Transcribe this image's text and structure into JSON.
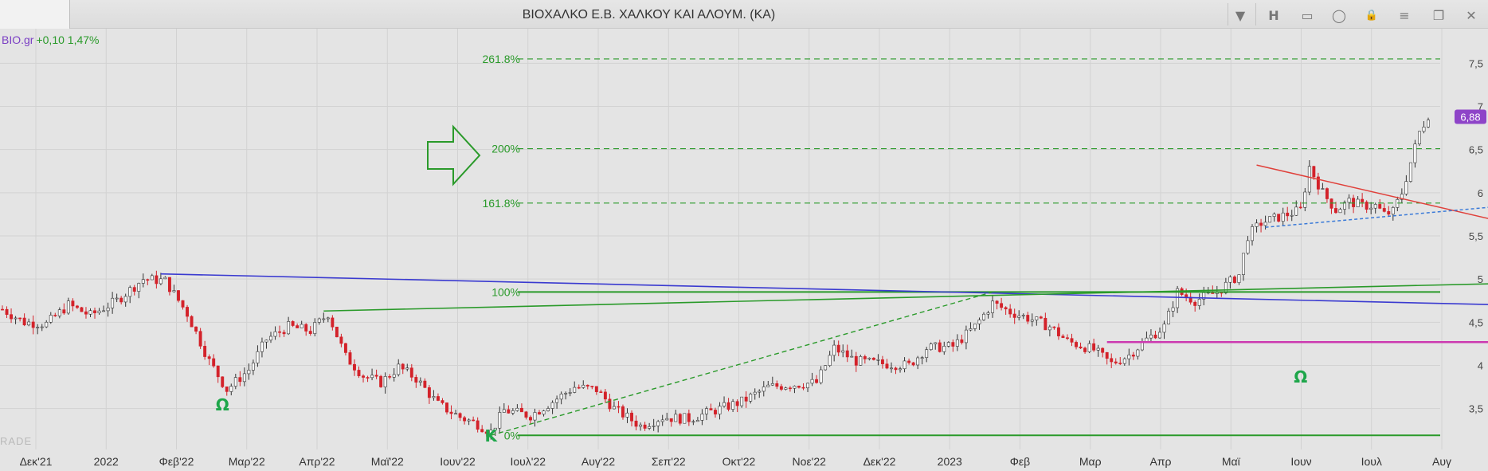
{
  "titlebar": {
    "title": "ΒΙΟΧΑΛΚΟ Ε.Β. ΧΑΛΚΟΥ  ΚΑΙ  ΑΛΟΥΜ. (ΚΑ)",
    "buttons": [
      {
        "name": "dropdown-chevron-icon",
        "glyph": "▼"
      },
      {
        "name": "h-button",
        "glyph": "H"
      },
      {
        "name": "panel-icon",
        "glyph": "▭"
      },
      {
        "name": "chat-icon",
        "glyph": "◯"
      },
      {
        "name": "lock-icon",
        "glyph": "🔒"
      },
      {
        "name": "menu-icon",
        "glyph": "≡"
      },
      {
        "name": "restore-icon",
        "glyph": "❐"
      },
      {
        "name": "close-icon",
        "glyph": "✕"
      }
    ]
  },
  "symbol_info": {
    "name": "BIO.gr",
    "change": "+0,10 1,47%"
  },
  "watermark": "RADE",
  "colors": {
    "background": "#e4e4e4",
    "grid": "#d2d2d2",
    "candle_up": "#ffffff",
    "candle_down": "#d3222a",
    "fib_green": "#2a9a2a",
    "blue_line": "#3a3ad0",
    "magenta_line": "#cc3ab0",
    "price_tag": "#8e44c8"
  },
  "chart_data": {
    "type": "candlestick",
    "price_axis": {
      "ticks": [
        "7,5",
        "7",
        "6,5",
        "6",
        "5,5",
        "5",
        "4,5",
        "4",
        "3,5"
      ],
      "values": [
        7.5,
        7,
        6.5,
        6,
        5.5,
        5,
        4.5,
        4,
        3.5
      ],
      "range": [
        3.1,
        7.9
      ]
    },
    "time_axis": {
      "labels": [
        "Δεκ'21",
        "2022",
        "Φεβ'22",
        "Μαρ'22",
        "Απρ'22",
        "Μαϊ'22",
        "Ιουν'22",
        "Ιουλ'22",
        "Αυγ'22",
        "Σεπ'22",
        "Οκτ'22",
        "Νοε'22",
        "Δεκ'22",
        "2023",
        "Φεβ",
        "Μαρ",
        "Απρ",
        "Μαϊ",
        "Ιουν",
        "Ιουλ",
        "Αυγ"
      ]
    },
    "last_price": "6,88",
    "last_value": 6.88,
    "fibonacci_levels": [
      {
        "label": "261.8%",
        "value": 7.55
      },
      {
        "label": "200%",
        "value": 6.51
      },
      {
        "label": "161.8%",
        "value": 5.88
      },
      {
        "label": "100%",
        "value": 4.85
      },
      {
        "label": "0%",
        "value": 3.19
      }
    ],
    "annotations": [
      {
        "text": "Ω",
        "date_index": 50,
        "price": 3.48
      },
      {
        "text": "Ω",
        "date_index": 295,
        "price": 3.8
      },
      {
        "text": "Κ",
        "date_index": 111,
        "price": 3.12
      }
    ],
    "trendlines": [
      {
        "name": "blue-resistance",
        "from": [
          36,
          5.06
        ],
        "to": [
          342,
          4.7
        ]
      },
      {
        "name": "green-channel-upper",
        "from": [
          73,
          4.63
        ],
        "to": [
          342,
          4.95
        ]
      },
      {
        "name": "green-dashed-trend",
        "from": [
          111,
          3.19
        ],
        "to": [
          225,
          4.85
        ]
      },
      {
        "name": "magenta-support",
        "from": [
          251,
          4.27
        ],
        "to": [
          342,
          4.27
        ]
      },
      {
        "name": "red-wedge-upper",
        "from": [
          285,
          6.32
        ],
        "to": [
          342,
          5.65
        ]
      },
      {
        "name": "blue-wedge-lower",
        "from": [
          287,
          5.6
        ],
        "to": [
          342,
          5.85
        ]
      }
    ],
    "price_path": [
      [
        0,
        4.65
      ],
      [
        5,
        4.5
      ],
      [
        10,
        4.48
      ],
      [
        15,
        4.7
      ],
      [
        20,
        4.58
      ],
      [
        26,
        4.75
      ],
      [
        32,
        5.0
      ],
      [
        37,
        4.98
      ],
      [
        42,
        4.6
      ],
      [
        47,
        4.05
      ],
      [
        51,
        3.72
      ],
      [
        56,
        3.95
      ],
      [
        60,
        4.3
      ],
      [
        65,
        4.45
      ],
      [
        70,
        4.4
      ],
      [
        74,
        4.6
      ],
      [
        78,
        4.1
      ],
      [
        82,
        3.88
      ],
      [
        86,
        3.8
      ],
      [
        90,
        3.98
      ],
      [
        94,
        3.85
      ],
      [
        99,
        3.55
      ],
      [
        104,
        3.4
      ],
      [
        108,
        3.32
      ],
      [
        111,
        3.23
      ],
      [
        114,
        3.48
      ],
      [
        120,
        3.42
      ],
      [
        125,
        3.58
      ],
      [
        130,
        3.75
      ],
      [
        135,
        3.72
      ],
      [
        139,
        3.5
      ],
      [
        145,
        3.3
      ],
      [
        150,
        3.4
      ],
      [
        156,
        3.38
      ],
      [
        162,
        3.48
      ],
      [
        168,
        3.58
      ],
      [
        174,
        3.75
      ],
      [
        180,
        3.78
      ],
      [
        185,
        3.8
      ],
      [
        189,
        4.2
      ],
      [
        194,
        4.05
      ],
      [
        200,
        4.02
      ],
      [
        206,
        4.0
      ],
      [
        210,
        4.2
      ],
      [
        216,
        4.22
      ],
      [
        221,
        4.45
      ],
      [
        225,
        4.72
      ],
      [
        229,
        4.62
      ],
      [
        233,
        4.55
      ],
      [
        238,
        4.45
      ],
      [
        242,
        4.28
      ],
      [
        248,
        4.18
      ],
      [
        252,
        4.02
      ],
      [
        256,
        4.12
      ],
      [
        260,
        4.3
      ],
      [
        264,
        4.45
      ],
      [
        267,
        4.85
      ],
      [
        271,
        4.75
      ],
      [
        276,
        4.85
      ],
      [
        281,
        5.05
      ],
      [
        283,
        5.5
      ],
      [
        286,
        5.65
      ],
      [
        289,
        5.7
      ],
      [
        292,
        5.75
      ],
      [
        295,
        5.8
      ],
      [
        297,
        6.3
      ],
      [
        300,
        6.0
      ],
      [
        303,
        5.8
      ],
      [
        306,
        5.9
      ],
      [
        309,
        5.85
      ],
      [
        312,
        5.85
      ],
      [
        314,
        5.75
      ],
      [
        316,
        5.78
      ],
      [
        318,
        6.0
      ],
      [
        320,
        6.35
      ],
      [
        322,
        6.7
      ],
      [
        324,
        6.9
      ]
    ],
    "n_bars": 325,
    "grid": true
  }
}
